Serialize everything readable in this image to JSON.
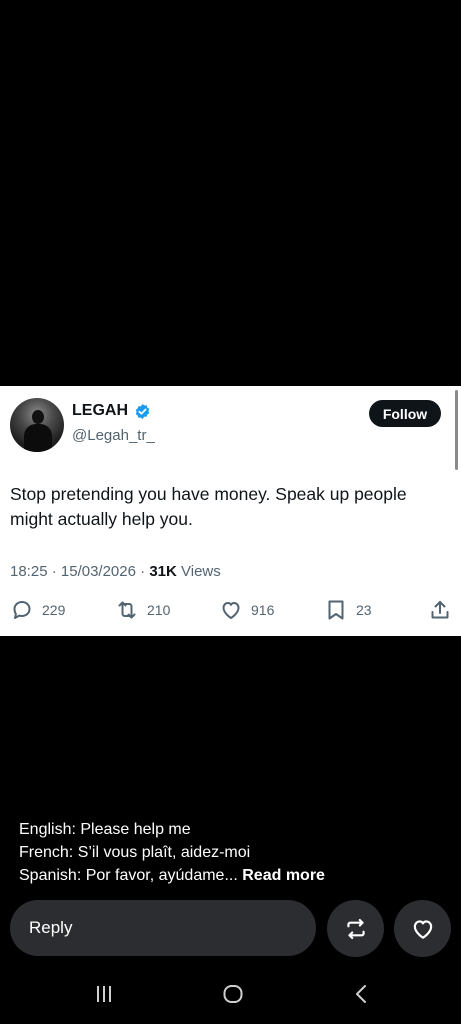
{
  "tweet": {
    "author_name": "LEGAH",
    "author_handle": "@Legah_tr_",
    "follow_label": "Follow",
    "text": "Stop pretending you have money. Speak up people might actually help you.",
    "time": "18:25",
    "date": "15/03/2026",
    "views_count": "31K",
    "views_label": "Views",
    "replies": "229",
    "reposts": "210",
    "likes": "916",
    "bookmarks": "23"
  },
  "caption": {
    "line1": "English: Please help me",
    "line2": "French: S’il vous plaît, aidez-moi",
    "line3": "Spanish: Por favor, ayúdame...",
    "read_more": "Read more"
  },
  "bottom_bar": {
    "reply_label": "Reply"
  },
  "icons": {
    "verified": "verified-badge-icon",
    "reply": "comment-icon",
    "repost": "repost-icon",
    "like": "heart-icon",
    "bookmark": "bookmark-icon",
    "share": "share-icon",
    "nav_recents": "recents-icon",
    "nav_home": "home-icon",
    "nav_back": "back-icon"
  },
  "colors": {
    "background": "#000000",
    "card": "#ffffff",
    "verified_blue": "#1d9bf0",
    "secondary_text": "#536471",
    "button_dark": "#2b2d31"
  }
}
